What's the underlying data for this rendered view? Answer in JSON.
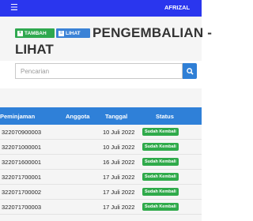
{
  "topbar": {
    "menu_icon": "hamburger-icon",
    "user_name": "AFRIZAL",
    "color": "#2a36ee"
  },
  "header": {
    "tambah_label": "TAMBAH",
    "lihat_label": "LIHAT",
    "title_line1": "PENGEMBALIAN -",
    "title_line2": "LIHAT"
  },
  "search": {
    "placeholder": "Pencarian",
    "value": "",
    "button_icon": "search-icon"
  },
  "table": {
    "columns": [
      "Peminjaman",
      "Anggota",
      "Tanggal",
      "Status"
    ],
    "rows": [
      {
        "id": "322070900003",
        "anggota": "",
        "tanggal": "10 Juli 2022",
        "status": "Sudah Kembali"
      },
      {
        "id": "322071000001",
        "anggota": "",
        "tanggal": "10 Juli 2022",
        "status": "Sudah Kembali"
      },
      {
        "id": "322071600001",
        "anggota": "",
        "tanggal": "16 Juli 2022",
        "status": "Sudah Kembali"
      },
      {
        "id": "322071700001",
        "anggota": "",
        "tanggal": "17 Juli 2022",
        "status": "Sudah Kembali"
      },
      {
        "id": "322071700002",
        "anggota": "",
        "tanggal": "17 Juli 2022",
        "status": "Sudah Kembali"
      },
      {
        "id": "322071700003",
        "anggota": "",
        "tanggal": "17 Juli 2022",
        "status": "Sudah Kembali"
      }
    ],
    "header_color": "#2f80d8",
    "status_color": "#2faa4a"
  }
}
